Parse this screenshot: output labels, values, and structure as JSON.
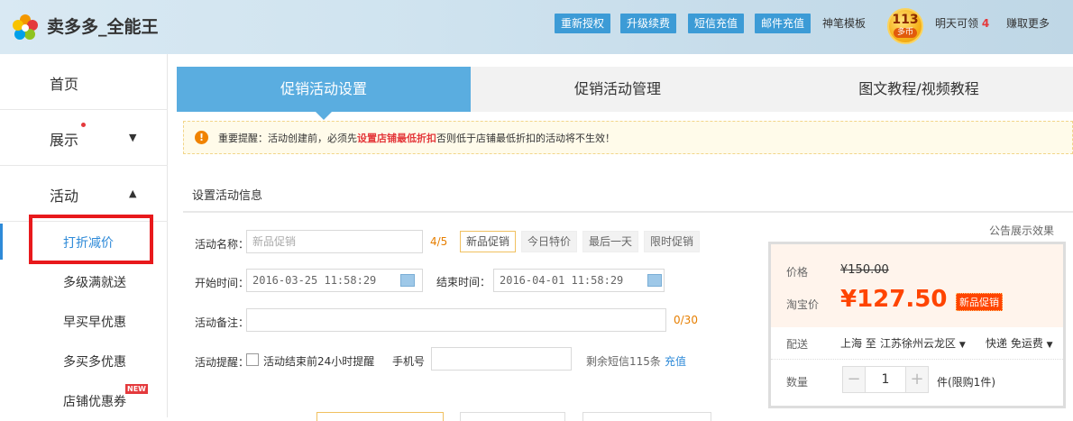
{
  "header": {
    "app_name": "卖多多_全能王",
    "buttons": [
      "重新授权",
      "升级续费",
      "短信充值",
      "邮件充值"
    ],
    "template_link": "神笔模板",
    "coin_count": "113",
    "coin_unit": "多币",
    "tomorrow_label": "明天可领",
    "tomorrow_count": "4",
    "earn_more": "赚取更多",
    "colors": {
      "button_bg": "#3c9bd6",
      "coin": "#f6b21a"
    }
  },
  "sidebar": {
    "home": "首页",
    "display": "展示",
    "activity": "活动",
    "sub_items": [
      "打折减价",
      "多级满就送",
      "早买早优惠",
      "多买多优惠",
      "店铺优惠券"
    ],
    "new_badge": "NEW",
    "active_color": "#2e8ad8"
  },
  "tabs": [
    "促销活动设置",
    "促销活动管理",
    "图文教程/视频教程"
  ],
  "notice": {
    "prefix": "重要提醒：活动创建前，必须先",
    "highlight": "设置店铺最低折扣",
    "suffix": "否则低于店铺最低折扣的活动将不生效！"
  },
  "section_title": "设置活动信息",
  "form": {
    "name_label": "活动名称：",
    "name_placeholder": "新品促销",
    "name_count": "4/5",
    "quick_tags": [
      "新品促销",
      "今日特价",
      "最后一天",
      "限时促销"
    ],
    "start_label": "开始时间：",
    "start_value": "2016-03-25 11:58:29",
    "end_label": "结束时间：",
    "end_value": "2016-04-01 11:58:29",
    "note_label": "活动备注：",
    "note_count": "0/30",
    "remind_label": "活动提醒：",
    "remind_option": "活动结束前24小时提醒",
    "phone_label": "手机号",
    "sms_left": "剩余短信115条",
    "recharge": "充值"
  },
  "preview": {
    "heading": "公告展示效果",
    "price_label": "价格",
    "orig_price": "¥150.00",
    "tb_label": "淘宝价",
    "promo_price": "¥127.50",
    "promo_tag": "新品促销",
    "ship_label": "配送",
    "ship_from": "上海 至",
    "ship_to": "江苏徐州云龙区",
    "ship_mode": "快递 免运费",
    "qty_label": "数量",
    "qty_value": "1",
    "qty_limit": "件(限购1件)"
  }
}
